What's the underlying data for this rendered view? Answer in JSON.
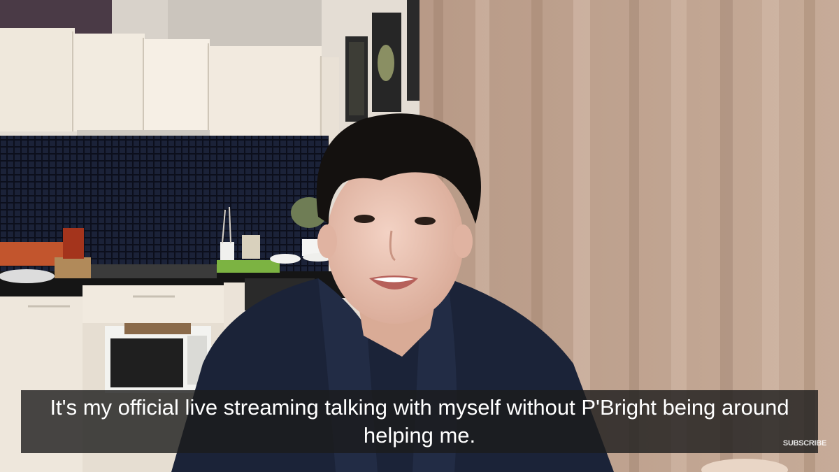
{
  "captions": {
    "line1": "It's my official live streaming talking with myself without P'Bright being around",
    "line2": "helping me."
  },
  "watermark": {
    "label": "SUBSCRIBE"
  }
}
